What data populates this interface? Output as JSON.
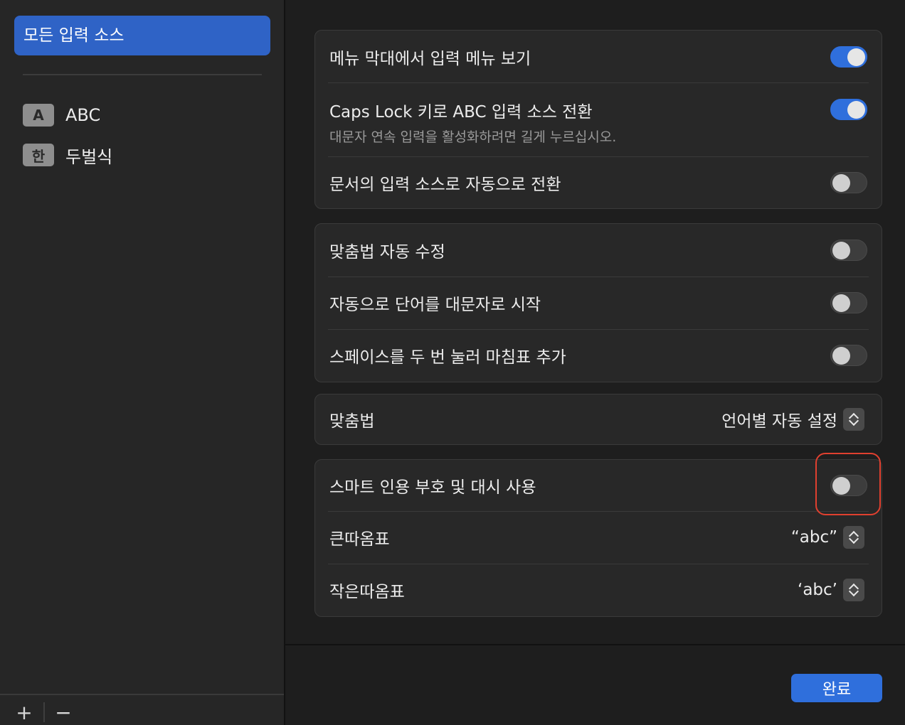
{
  "sidebar": {
    "selected_label": "모든 입력 소스",
    "sources": [
      {
        "badge": "A",
        "label": "ABC"
      },
      {
        "badge": "한",
        "label": "두벌식"
      }
    ],
    "add_label": "+",
    "remove_label": "−"
  },
  "group1": {
    "rows": [
      {
        "label": "메뉴 막대에서 입력 메뉴 보기",
        "toggle": true
      },
      {
        "label": "Caps Lock 키로 ABC 입력 소스 전환",
        "sublabel": "대문자 연속 입력을 활성화하려면 길게 누르십시오.",
        "toggle": true
      },
      {
        "label": "문서의 입력 소스로 자동으로 전환",
        "toggle": false
      }
    ]
  },
  "group2": {
    "rows": [
      {
        "label": "맞춤법 자동 수정",
        "toggle": false
      },
      {
        "label": "자동으로 단어를 대문자로 시작",
        "toggle": false
      },
      {
        "label": "스페이스를 두 번 눌러 마침표 추가",
        "toggle": false
      }
    ]
  },
  "group3": {
    "label": "맞춤법",
    "value": "언어별 자동 설정"
  },
  "group4": {
    "smart_quotes_label": "스마트 인용 부호 및 대시 사용",
    "smart_quotes_toggle": false,
    "double_quotes_label": "큰따옴표",
    "double_quotes_value": "“abc”",
    "single_quotes_label": "작은따옴표",
    "single_quotes_value": "‘abc’"
  },
  "done_label": "완료",
  "colors": {
    "accent": "#2f6fdc",
    "selection": "#2f63c6",
    "highlight": "#e0402f"
  }
}
